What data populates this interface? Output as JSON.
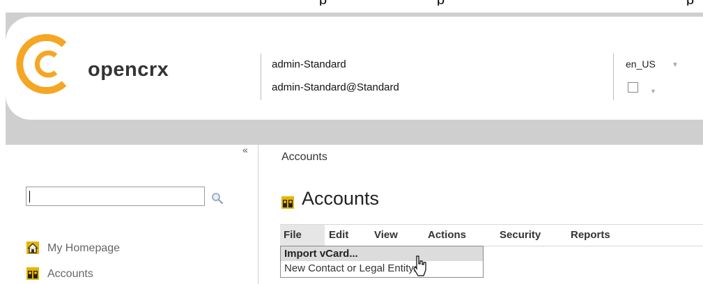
{
  "top_strip": [
    "p",
    "p",
    "p"
  ],
  "brand": {
    "logo_text": "opencrx",
    "accent": "#f5a623"
  },
  "user": {
    "name": "admin-Standard",
    "principal": "admin-Standard@Standard"
  },
  "locale": {
    "value": "en_US"
  },
  "sidebar": {
    "collapse_label": "«",
    "search": {
      "value": "",
      "placeholder": ""
    },
    "items": [
      {
        "label": "My Homepage",
        "icon": "home-icon"
      },
      {
        "label": "Accounts",
        "icon": "accounts-icon"
      }
    ]
  },
  "main": {
    "breadcrumb": "Accounts",
    "title": "Accounts",
    "menu": [
      "File",
      "Edit",
      "View",
      "Actions",
      "Security",
      "Reports"
    ],
    "file_dropdown": [
      "Import vCard...",
      "New Contact or Legal Entity..."
    ]
  },
  "colors": {
    "header_bg": "#cfcfcf",
    "menu_highlight": "#e6e6e6"
  }
}
